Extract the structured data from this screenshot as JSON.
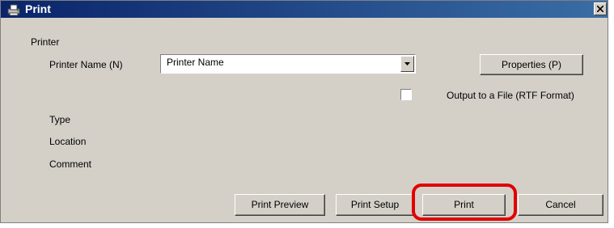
{
  "window": {
    "title": "Print"
  },
  "printer": {
    "group_label": "Printer",
    "name_label": "Printer Name (N)",
    "name_value": "Printer Name",
    "properties_label": "Properties (P)",
    "output_file_label": "Output to a File (RTF Format)",
    "output_file_checked": false,
    "type_label": "Type",
    "location_label": "Location",
    "comment_label": "Comment"
  },
  "buttons": {
    "print_preview": "Print Preview",
    "print_setup": "Print Setup",
    "print": "Print",
    "cancel": "Cancel"
  },
  "colors": {
    "titlebar": "#0a246a",
    "face": "#d4d0c8",
    "highlight": "#e10000"
  },
  "icons": {
    "app": "printer-icon",
    "close": "close-icon",
    "dropdown": "chevron-down-icon"
  }
}
